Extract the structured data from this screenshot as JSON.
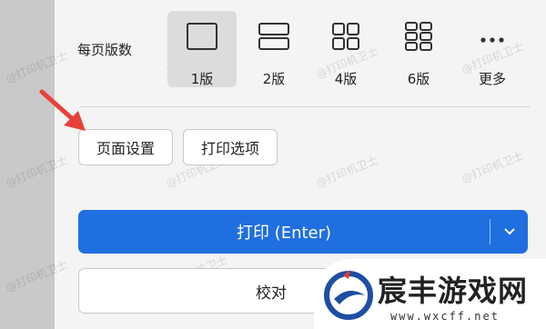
{
  "pages_per_sheet": {
    "label": "每页版数",
    "options": [
      {
        "label": "1版",
        "icon": "single-page-icon",
        "selected": true
      },
      {
        "label": "2版",
        "icon": "two-pages-icon",
        "selected": false
      },
      {
        "label": "4版",
        "icon": "four-pages-icon",
        "selected": false
      },
      {
        "label": "6版",
        "icon": "six-pages-icon",
        "selected": false
      },
      {
        "label": "更多",
        "icon": "more-dots-icon",
        "selected": false
      }
    ]
  },
  "buttons": {
    "page_setup": "页面设置",
    "print_options": "打印选项",
    "print": "打印 (Enter)",
    "proof": "校对"
  },
  "watermark": "@打印机卫士",
  "site_logo": {
    "name": "宸丰游戏网",
    "url": "www.wxcff.net"
  },
  "colors": {
    "primary": "#1f6fe0",
    "arrow": "#e8413a",
    "logo_blue": "#1e4fa3",
    "logo_red": "#e23a2e"
  }
}
